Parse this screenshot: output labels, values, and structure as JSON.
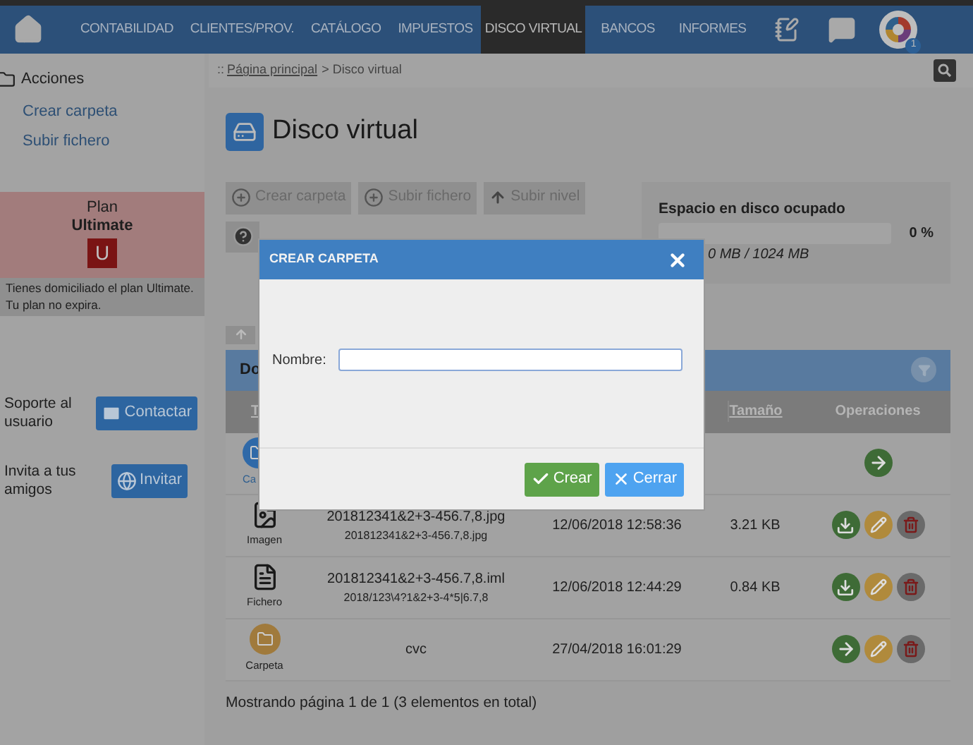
{
  "nav": {
    "items": [
      {
        "label": "CONTABILIDAD",
        "selected": false
      },
      {
        "label": "CLIENTES/PROV.",
        "selected": false
      },
      {
        "label": "CATÁLOGO",
        "selected": false
      },
      {
        "label": "IMPUESTOS",
        "selected": false
      },
      {
        "label": "DISCO VIRTUAL",
        "selected": true
      },
      {
        "label": "BANCOS",
        "selected": false
      },
      {
        "label": "INFORMES",
        "selected": false
      }
    ],
    "badge": "1"
  },
  "sidebar": {
    "title": "Acciones",
    "actions": [
      "Crear carpeta",
      "Subir fichero"
    ],
    "plan": {
      "label": "Plan",
      "name": "Ultimate",
      "letter": "U",
      "note": "Tienes domiciliado el plan Ultimate. Tu plan no expira."
    },
    "support": {
      "text": "Soporte al usuario",
      "button": "Contactar"
    },
    "invite": {
      "text": "Invita a tus amigos",
      "button": "Invitar"
    }
  },
  "breadcrumb": {
    "prefix": "::",
    "link": "Página principal",
    "rest": "> Disco virtual"
  },
  "title": "Disco virtual",
  "toolbar": [
    {
      "kind": "add",
      "label": "Crear carpeta"
    },
    {
      "kind": "add",
      "label": "Subir fichero"
    },
    {
      "kind": "up",
      "label": "Subir nivel"
    }
  ],
  "disk": {
    "title": "Espacio en disco ocupado",
    "level": 0,
    "percent": "0 %",
    "usage": "0 MB / 1024 MB"
  },
  "table": {
    "title": "Do",
    "columns": [
      "T",
      "Tamaño",
      "Operaciones"
    ],
    "rows": [
      {
        "kind": "up",
        "type": "Ca",
        "operations": [
          {
            "kind": "open"
          }
        ]
      },
      {
        "kind": "image",
        "type": "Imagen",
        "name": "201812341&2+3-456.7,8.jpg",
        "subname": "201812341&2+3-456.7,8.jpg",
        "date": "12/06/2018 12:58:36",
        "size": "3.21 KB",
        "operations": [
          {
            "kind": "download"
          },
          {
            "kind": "edit"
          },
          {
            "kind": "delete"
          }
        ]
      },
      {
        "kind": "file",
        "type": "Fichero",
        "name": "201812341&2+3-456.7,8.iml",
        "subname": "2018/123\\4?1&2+3-4*5|6.7,8",
        "date": "12/06/2018 12:44:29",
        "size": "0.84 KB",
        "operations": [
          {
            "kind": "download"
          },
          {
            "kind": "edit"
          },
          {
            "kind": "delete"
          }
        ]
      },
      {
        "kind": "folder",
        "type": "Carpeta",
        "name": "cvc",
        "date": "27/04/2018 16:01:29",
        "operations": [
          {
            "kind": "open"
          },
          {
            "kind": "edit"
          },
          {
            "kind": "delete"
          }
        ]
      }
    ],
    "footer": "Mostrando página 1 de 1 (3 elementos en total)"
  },
  "modal": {
    "title": "CREAR CARPETA",
    "field_label": "Nombre:",
    "buttons": [
      {
        "kind": "confirm",
        "label": "Crear"
      },
      {
        "kind": "cancel",
        "label": "Cerrar"
      }
    ]
  }
}
